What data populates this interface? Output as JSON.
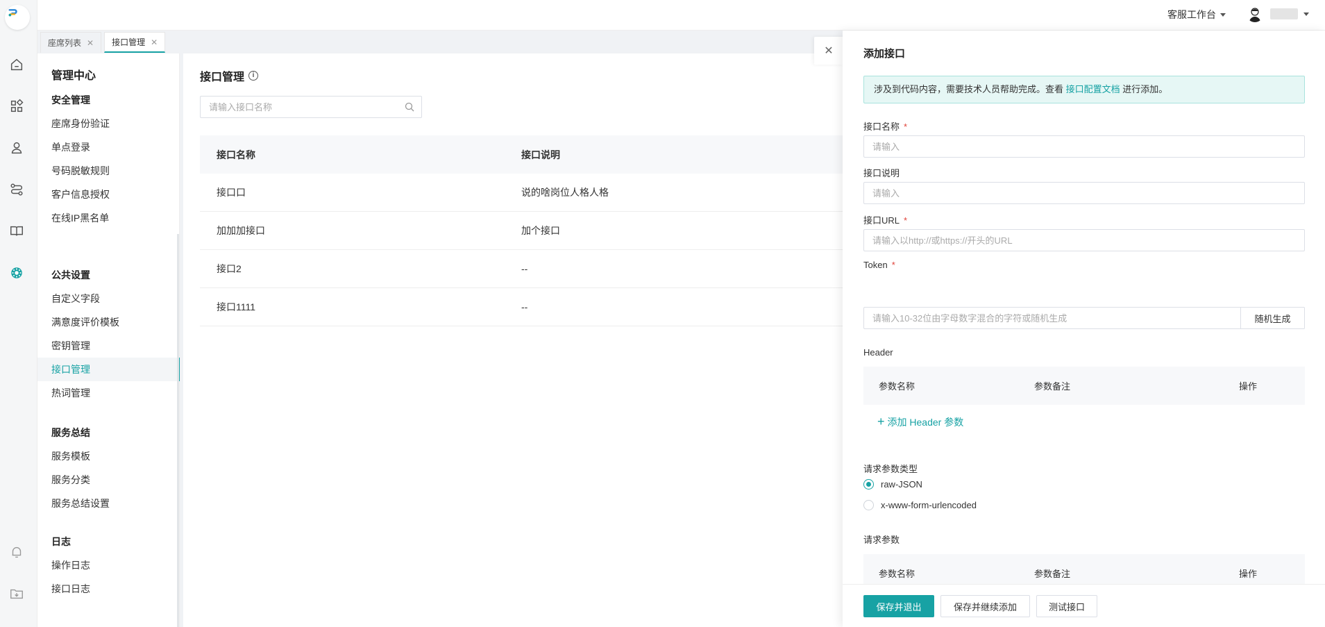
{
  "header": {
    "workbench_label": "客服工作台"
  },
  "tabs": [
    {
      "label": "座席列表",
      "close": "✕"
    },
    {
      "label": "接口管理",
      "close": "✕"
    }
  ],
  "sidebar": {
    "title": "管理中心",
    "groups": [
      {
        "title": "安全管理",
        "items": [
          "座席身份验证",
          "单点登录",
          "号码脱敏规则",
          "客户信息授权",
          "在线IP黑名单"
        ]
      },
      {
        "title": "公共设置",
        "items": [
          "自定义字段",
          "满意度评价模板",
          "密钥管理",
          "接口管理",
          "热词管理"
        ]
      },
      {
        "title": "服务总结",
        "items": [
          "服务模板",
          "服务分类",
          "服务总结设置"
        ]
      },
      {
        "title": "日志",
        "items": [
          "操作日志",
          "接口日志"
        ]
      }
    ],
    "active_item": "接口管理"
  },
  "main": {
    "title": "接口管理",
    "info_icon": "i",
    "search_placeholder": "请输入接口名称",
    "table": {
      "columns": [
        "接口名称",
        "接口说明"
      ],
      "rows": [
        [
          "接口口",
          "说的啥岗位人格人格"
        ],
        [
          "加加加接口",
          "加个接口"
        ],
        [
          "接口2",
          "--"
        ],
        [
          "接口1111",
          "--"
        ]
      ]
    }
  },
  "drawer": {
    "title": "添加接口",
    "notice": {
      "before": "涉及到代码内容，需要技术人员帮助完成。查看 ",
      "link": "接口配置文档",
      "after": " 进行添加。"
    },
    "fields": {
      "name_label": "接口名称",
      "name_placeholder": "请输入",
      "desc_label": "接口说明",
      "desc_placeholder": "请输入",
      "url_label": "接口URL",
      "url_placeholder": "请输入以http://或https://开头的URL",
      "token_label": "Token",
      "token_placeholder": "请输入10-32位由字母数字混合的字符或随机生成",
      "token_button": "随机生成",
      "required_mark": "*"
    },
    "header_section": {
      "label": "Header",
      "columns": [
        "参数名称",
        "参数备注",
        "操作"
      ],
      "add_link": "添加 Header 参数",
      "add_plus": "+"
    },
    "request_type": {
      "label": "请求参数类型",
      "options": [
        "raw-JSON",
        "x-www-form-urlencoded"
      ],
      "selected": "raw-JSON"
    },
    "request_params": {
      "label": "请求参数",
      "columns": [
        "参数名称",
        "参数备注",
        "操作"
      ]
    },
    "footer": {
      "save_exit": "保存并退出",
      "save_continue": "保存并继续添加",
      "test": "测试接口"
    },
    "close": "✕"
  },
  "colors": {
    "accent": "#17a2a4",
    "required": "#e0423a",
    "notice_bg": "#e6f7f5"
  }
}
